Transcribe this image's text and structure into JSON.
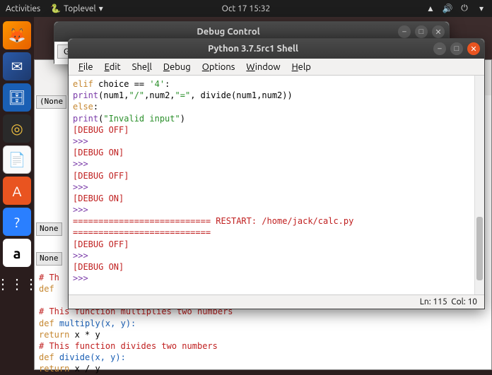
{
  "topbar": {
    "activities": "Activities",
    "app": "Toplevel",
    "clock": "Oct 17  15:32"
  },
  "launcher": {
    "firefox": "🦊",
    "thunderbird": "✉",
    "files": "🗄",
    "media": "◎",
    "writer": "📄",
    "store": "A",
    "help": "?",
    "amazon": "a",
    "apps": "⋮⋮⋮"
  },
  "debug_window": {
    "title": "Debug Control",
    "go": "Go"
  },
  "shell_window": {
    "title": "Python 3.7.5rc1 Shell",
    "menu": {
      "file": "File",
      "edit": "Edit",
      "shell": "Shell",
      "debug": "Debug",
      "options": "Options",
      "window": "Window",
      "help": "Help"
    },
    "status": {
      "ln": "Ln: 115",
      "col": "Col: 10"
    }
  },
  "shell_content": {
    "l1a": "elif",
    "l1b": " choice == ",
    "l1c": "'4'",
    "l1d": ":",
    "l2a": "    ",
    "l2b": "print",
    "l2c": "(num1,",
    "l2d": "\"/\"",
    "l2e": ",num2,",
    "l2f": "\"=\"",
    "l2g": ", divide(num1,num2))",
    "l3": "",
    "l4a": "else",
    "l4b": ":",
    "l5a": "    ",
    "l5b": "print",
    "l5c": "(",
    "l5d": "\"Invalid input\"",
    "l5e": ")",
    "l6": "[DEBUG OFF]",
    "l7": ">>> ",
    "l8": "[DEBUG ON]",
    "l9": ">>> ",
    "l10": "[DEBUG OFF]",
    "l11": ">>> ",
    "l12": "[DEBUG ON]",
    "l13": ">>> ",
    "l14": "=========================== RESTART: /home/jack/calc.py ===========================",
    "l15": "[DEBUG OFF]",
    "l16": ">>> ",
    "l17": "[DEBUG ON]",
    "l18": ">>> "
  },
  "bg": {
    "none1": "(None",
    "none2": "None",
    "none3": "None",
    "th": "# Th",
    "defl": "def ",
    "c1": "# This function multiplies two numbers",
    "d1a": "def",
    "d1b": " multiply(x, y):",
    "r1a": "    return",
    "r1b": " x * y",
    "c2": "# This function divides two numbers",
    "d2a": "def",
    "d2b": " divide(x, y):",
    "r2a": "    return",
    "r2b": " x / y"
  }
}
